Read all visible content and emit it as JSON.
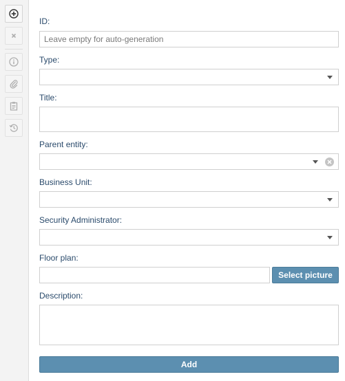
{
  "toolbar": {
    "buttons": [
      {
        "icon": "plus-circle-icon",
        "enabled": true
      },
      {
        "icon": "close-icon",
        "enabled": false
      },
      {
        "icon": "info-icon",
        "enabled": false
      },
      {
        "icon": "paperclip-icon",
        "enabled": false
      },
      {
        "icon": "clipboard-icon",
        "enabled": false
      },
      {
        "icon": "history-icon",
        "enabled": false
      }
    ]
  },
  "form": {
    "id": {
      "label": "ID:",
      "placeholder": "Leave empty for auto-generation",
      "value": ""
    },
    "type": {
      "label": "Type:",
      "value": ""
    },
    "title": {
      "label": "Title:",
      "value": ""
    },
    "parent_entity": {
      "label": "Parent entity:",
      "value": ""
    },
    "business_unit": {
      "label": "Business Unit:",
      "value": ""
    },
    "security_admin": {
      "label": "Security Administrator:",
      "value": ""
    },
    "floor_plan": {
      "label": "Floor plan:",
      "value": "",
      "select_label": "Select picture"
    },
    "description": {
      "label": "Description:",
      "value": ""
    },
    "add_label": "Add"
  },
  "colors": {
    "button_blue": "#5c8fb0",
    "label_blue": "#2a4a6b"
  }
}
